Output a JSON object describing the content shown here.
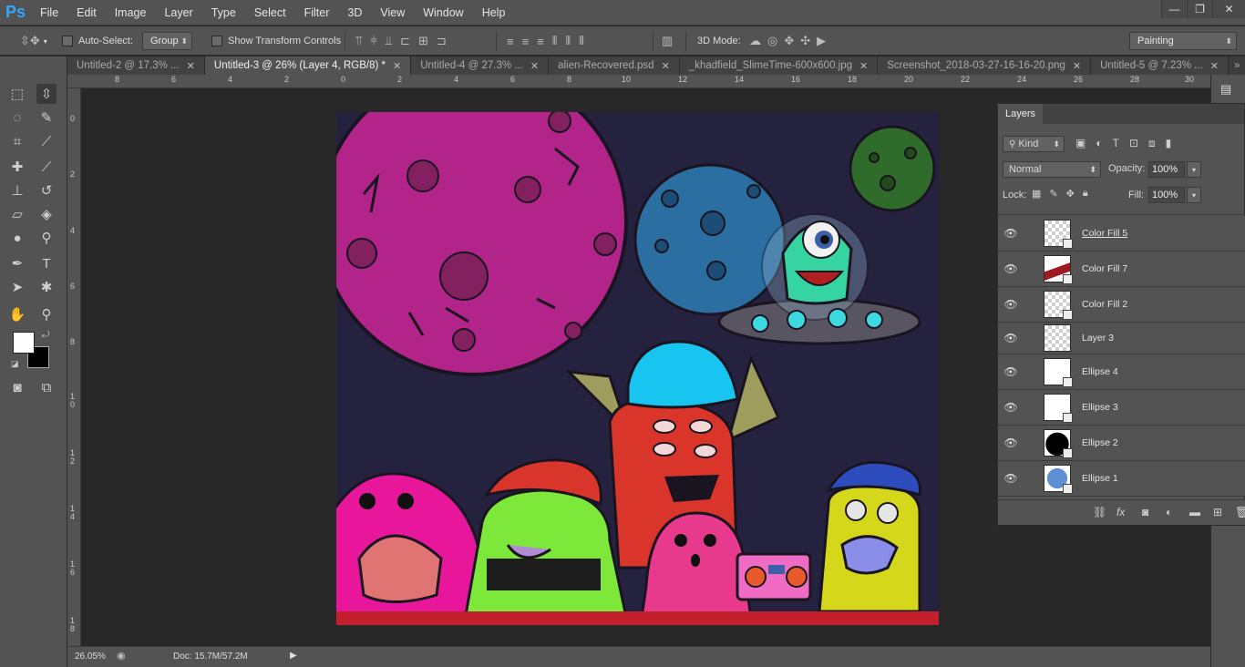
{
  "app": {
    "logo": "Ps"
  },
  "menu": [
    "File",
    "Edit",
    "Image",
    "Layer",
    "Type",
    "Select",
    "Filter",
    "3D",
    "View",
    "Window",
    "Help"
  ],
  "window_controls": {
    "minimize": "—",
    "restore": "❐",
    "close": "✕"
  },
  "options": {
    "auto_select_label": "Auto-Select:",
    "auto_select_value": "Group",
    "show_transform_label": "Show Transform Controls",
    "mode_3d_label": "3D Mode:",
    "workspace_value": "Painting"
  },
  "tabs": [
    {
      "label": "Untitled-2 @ 17.3% ...",
      "close": "✕",
      "active": false
    },
    {
      "label": "Untitled-3 @ 26% (Layer 4, RGB/8) *",
      "close": "✕",
      "active": true
    },
    {
      "label": "Untitled-4 @ 27.3% ...",
      "close": "✕",
      "active": false
    },
    {
      "label": "alien-Recovered.psd",
      "close": "✕",
      "active": false
    },
    {
      "label": "_khadfield_SlimeTime-600x600.jpg",
      "close": "✕",
      "active": false
    },
    {
      "label": "Screenshot_2018-03-27-16-16-20.png",
      "close": "✕",
      "active": false
    },
    {
      "label": "Untitled-5 @ 7.23% ...",
      "close": "✕",
      "active": false
    }
  ],
  "tab_overflow": "»",
  "ruler_h": [
    "8",
    "6",
    "4",
    "2",
    "0",
    "2",
    "4",
    "6",
    "8",
    "10",
    "12",
    "14",
    "16",
    "18",
    "20",
    "22",
    "24",
    "26",
    "28",
    "30"
  ],
  "ruler_v": [
    "0",
    "2",
    "4",
    "6",
    "8",
    "1 0",
    "1 2",
    "1 4",
    "1 6",
    "1 8"
  ],
  "status": {
    "zoom": "26.05%",
    "doc": "Doc: 15.7M/57.2M"
  },
  "layers_panel": {
    "tab": "Layers",
    "filter_kind": "Kind",
    "blend_mode": "Normal",
    "opacity_label": "Opacity:",
    "opacity_value": "100%",
    "lock_label": "Lock:",
    "fill_label": "Fill:",
    "fill_value": "100%",
    "layers": [
      {
        "name": "Color Fill 5"
      },
      {
        "name": "Color Fill 7"
      },
      {
        "name": "Color Fill 2"
      },
      {
        "name": "Layer 3"
      },
      {
        "name": "Ellipse 4"
      },
      {
        "name": "Ellipse 3"
      },
      {
        "name": "Ellipse 2"
      },
      {
        "name": "Ellipse 1"
      }
    ]
  },
  "colors": {
    "accent": "#31a8ff",
    "canvas_bg": "#252240"
  }
}
